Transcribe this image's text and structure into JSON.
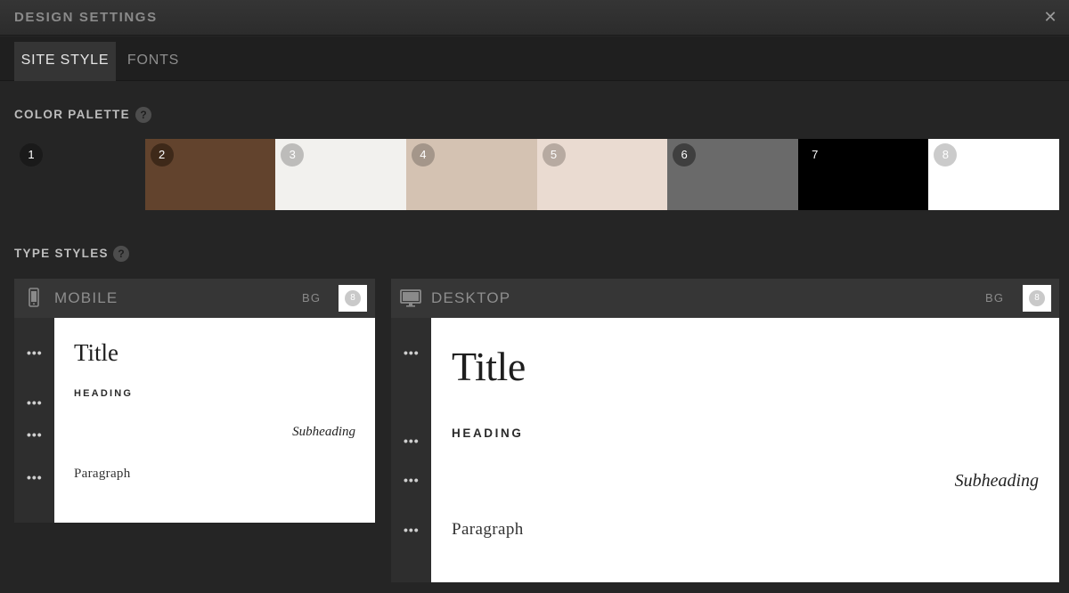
{
  "window": {
    "title": "DESIGN SETTINGS",
    "close_glyph": "✕"
  },
  "tabs": [
    {
      "label": "SITE STYLE",
      "active": true
    },
    {
      "label": "FONTS",
      "active": false
    }
  ],
  "color_palette": {
    "label": "COLOR PALETTE",
    "help_glyph": "?",
    "swatches": [
      {
        "number": "1",
        "color": "#252525",
        "badge_bg": "#1a1a1a",
        "badge_fg": "#ffffff"
      },
      {
        "number": "2",
        "color": "#62432d",
        "badge_bg": "#3e2919",
        "badge_fg": "#ffffff"
      },
      {
        "number": "3",
        "color": "#f2f1ee",
        "badge_bg": "#bdbcba",
        "badge_fg": "#ffffff"
      },
      {
        "number": "4",
        "color": "#d4c2b2",
        "badge_bg": "#a4968a",
        "badge_fg": "#ffffff"
      },
      {
        "number": "5",
        "color": "#eadbd1",
        "badge_bg": "#b7aaa1",
        "badge_fg": "#ffffff"
      },
      {
        "number": "6",
        "color": "#6a6a6a",
        "badge_bg": "#3f3f3f",
        "badge_fg": "#ffffff"
      },
      {
        "number": "7",
        "color": "#000000",
        "badge_bg": "#000000",
        "badge_fg": "#ffffff"
      },
      {
        "number": "8",
        "color": "#ffffff",
        "badge_bg": "#cbcbcb",
        "badge_fg": "#ffffff"
      }
    ]
  },
  "type_styles": {
    "label": "TYPE STYLES",
    "help_glyph": "?",
    "more_glyph": "•••",
    "mobile": {
      "label": "MOBILE",
      "bg_label": "BG",
      "bg_value": "8",
      "icon": "phone-icon",
      "samples": {
        "title": "Title",
        "heading": "HEADING",
        "subheading": "Subheading",
        "paragraph": "Paragraph"
      }
    },
    "desktop": {
      "label": "DESKTOP",
      "bg_label": "BG",
      "bg_value": "8",
      "icon": "monitor-icon",
      "samples": {
        "title": "Title",
        "heading": "HEADING",
        "subheading": "Subheading",
        "paragraph": "Paragraph"
      }
    }
  }
}
